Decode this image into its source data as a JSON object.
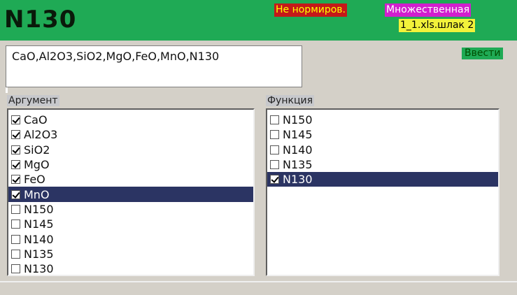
{
  "header": {
    "title": "N130",
    "norm_badge": "Не нормиров.",
    "mode_badge": "Множественная",
    "file_badge": "1_1.xls.шлак 2"
  },
  "formula": {
    "value": "CaO,Al2O3,SiO2,MgO,FeO,MnO,N130"
  },
  "enter_button": "Ввести",
  "argument": {
    "label": "Аргумент",
    "items": [
      {
        "label": "CaO",
        "checked": true,
        "selected": false
      },
      {
        "label": "Al2O3",
        "checked": true,
        "selected": false
      },
      {
        "label": "SiO2",
        "checked": true,
        "selected": false
      },
      {
        "label": "MgO",
        "checked": true,
        "selected": false
      },
      {
        "label": "FeO",
        "checked": true,
        "selected": false
      },
      {
        "label": "MnO",
        "checked": true,
        "selected": true
      },
      {
        "label": "N150",
        "checked": false,
        "selected": false
      },
      {
        "label": "N145",
        "checked": false,
        "selected": false
      },
      {
        "label": "N140",
        "checked": false,
        "selected": false
      },
      {
        "label": "N135",
        "checked": false,
        "selected": false
      },
      {
        "label": "N130",
        "checked": false,
        "selected": false
      }
    ]
  },
  "function": {
    "label": "Функция",
    "items": [
      {
        "label": "N150",
        "checked": false,
        "selected": false
      },
      {
        "label": "N145",
        "checked": false,
        "selected": false
      },
      {
        "label": "N140",
        "checked": false,
        "selected": false
      },
      {
        "label": "N135",
        "checked": false,
        "selected": false
      },
      {
        "label": "N130",
        "checked": true,
        "selected": true
      }
    ]
  },
  "colors": {
    "header_bg": "#1faa55",
    "norm_bg": "#c41919",
    "mode_bg": "#d11fce",
    "file_bg": "#f2f23a",
    "selection_bg": "#2b3463"
  }
}
